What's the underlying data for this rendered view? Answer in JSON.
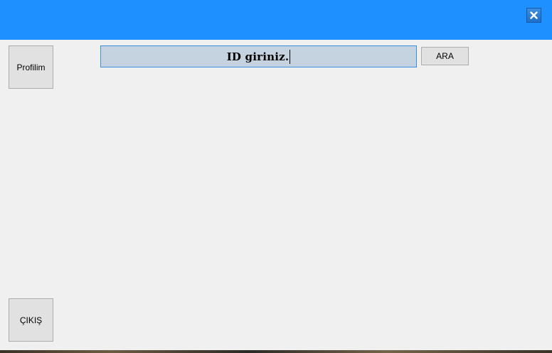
{
  "titlebar": {
    "accent_color": "#1e90ff",
    "close_icon": "close-icon"
  },
  "sidebar": {
    "profile_label": "Profilim",
    "exit_label": "ÇIKIŞ"
  },
  "search": {
    "value": "ID giriniz.",
    "button_label": "ARA"
  }
}
